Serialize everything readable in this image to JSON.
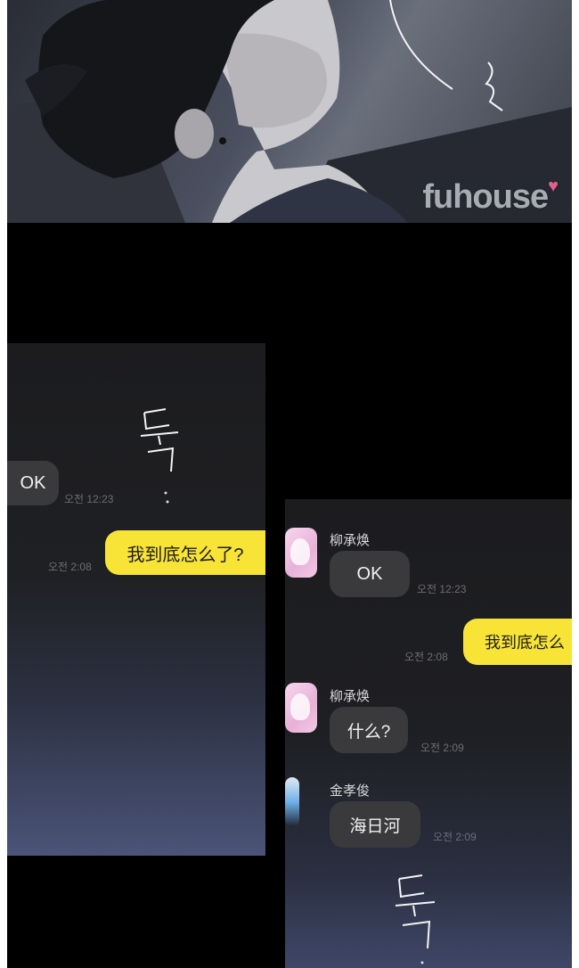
{
  "watermark": {
    "text": "fuhouse"
  },
  "left_chat": {
    "received": {
      "text": "OK",
      "time": "오전 12:23"
    },
    "sent": {
      "text": "我到底怎么了?",
      "time": "오전 2:08"
    }
  },
  "right_chat": {
    "messages": [
      {
        "sender": "柳承焕",
        "text": "OK",
        "time": "오전 12:23"
      },
      {
        "text": "我到底怎么",
        "time": "오전 2:08"
      },
      {
        "sender": "柳承焕",
        "text": "什么?",
        "time": "오전 2:09"
      },
      {
        "sender": "金孝俊",
        "text": "海日河",
        "time": "오전 2:09"
      }
    ]
  },
  "colors": {
    "sent_bubble": "#f7e436",
    "received_bubble": "#3a3a3d",
    "background": "#000000",
    "watermark_heart": "#e0608a"
  }
}
